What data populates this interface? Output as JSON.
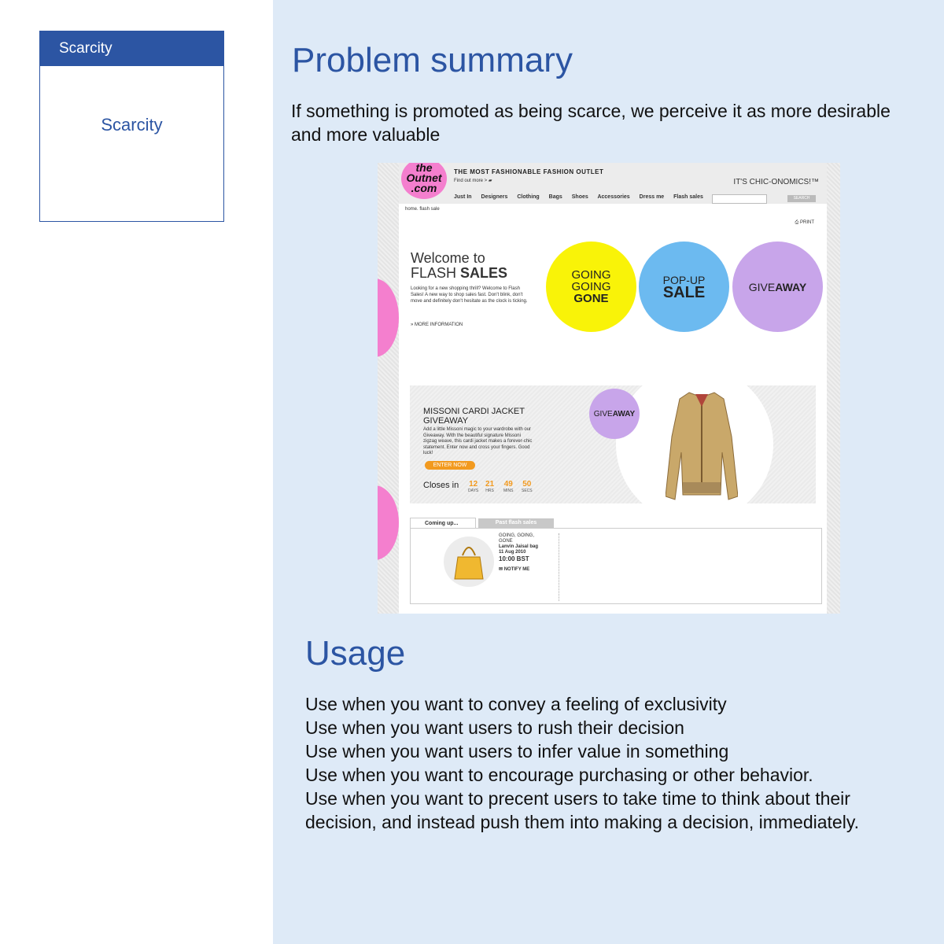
{
  "card": {
    "header": "Scarcity",
    "body": "Scarcity"
  },
  "summary": {
    "title": "Problem summary",
    "text": "If something is promoted as being scarce, we perceive it as more desirable and more valuable"
  },
  "screenshot": {
    "logo": "the Outnet .com",
    "tagline": "THE MOST FASHIONABLE FASHION OUTLET",
    "find_more": "Find out more >",
    "slogan": "IT'S CHIC-ONOMICS!™",
    "nav": [
      "Just In",
      "Designers",
      "Clothing",
      "Bags",
      "Shoes",
      "Accessories",
      "Dress me",
      "Flash sales"
    ],
    "search_label": "SEARCH",
    "breadcrumb": "home. flash sale",
    "print": "PRINT",
    "welcome_line1": "Welcome to",
    "welcome_line2a": "FLASH ",
    "welcome_line2b": "SALES",
    "welcome_desc": "Looking for a new shopping thrill? Welcome to Flash Sales! A new way to shop sales fast. Don't blink, don't move and definitely don't hesitate as the clock is ticking.",
    "more_info": "» MORE INFORMATION",
    "circles": {
      "going1": "GOING",
      "going2": "GOING",
      "gone": "GONE",
      "popup": "POP-UP",
      "sale": "SALE",
      "give": "GIVE",
      "away": "AWAY"
    },
    "banner": {
      "title1": "MISSONI CARDI JACKET",
      "title2": "GIVEAWAY",
      "desc": "Add a little Missoni magic to your wardrobe with our Giveaway. With the beautiful signature Missoni zigzag weave, this cardi jacket makes a forever-chic statement. Enter now and cross your fingers. Good luck!",
      "enter": "ENTER NOW",
      "closes": "Closes in",
      "countdown": [
        {
          "value": "12",
          "unit": "DAYS"
        },
        {
          "value": "21",
          "unit": "HRS"
        },
        {
          "value": "49",
          "unit": "MINS"
        },
        {
          "value": "50",
          "unit": "SECS"
        }
      ]
    },
    "tabs": {
      "coming": "Coming up...",
      "past": "Past flash sales"
    },
    "item": {
      "type1": "GOING, GOING,",
      "type2": "GONE",
      "name": "Lanvin Jaisal bag",
      "date": "11 Aug 2010",
      "time": "10:00 BST",
      "notify": "NOTIFY ME"
    }
  },
  "usage": {
    "title": "Usage",
    "items": [
      "Use when you want to convey a feeling of exclusivity",
      "Use when you want users to rush their decision",
      "Use when you want users to infer value in something",
      "Use when you want to encourage purchasing or other behavior.",
      "Use when you want to precent users to take time to think about their decision, and instead push them into making a decision, immediately."
    ]
  }
}
